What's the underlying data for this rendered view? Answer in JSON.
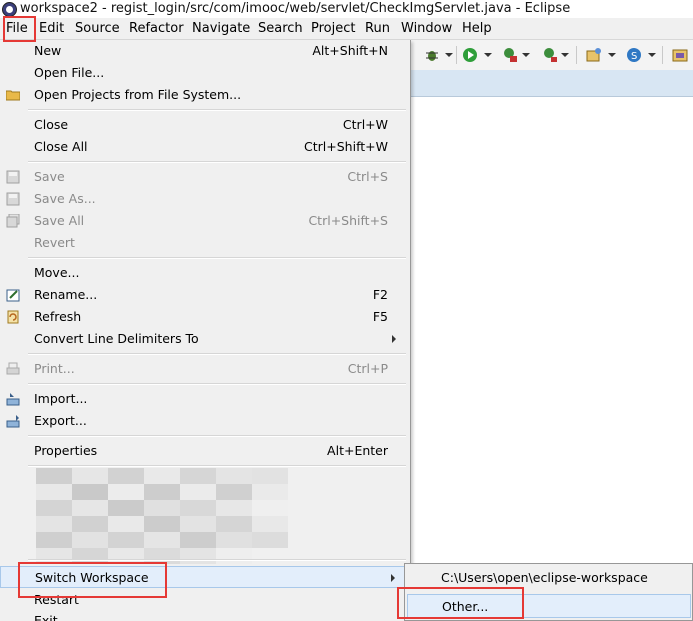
{
  "window": {
    "title": "workspace2 - regist_login/src/com/imooc/web/servlet/CheckImgServlet.java - Eclipse"
  },
  "menubar": {
    "items": [
      "File",
      "Edit",
      "Source",
      "Refactor",
      "Navigate",
      "Search",
      "Project",
      "Run",
      "Window",
      "Help"
    ]
  },
  "file_menu": {
    "new": {
      "label": "New",
      "shortcut": "Alt+Shift+N",
      "has_submenu": true
    },
    "open_file": {
      "label": "Open File..."
    },
    "open_projects": {
      "label": "Open Projects from File System..."
    },
    "close": {
      "label": "Close",
      "shortcut": "Ctrl+W"
    },
    "close_all": {
      "label": "Close All",
      "shortcut": "Ctrl+Shift+W"
    },
    "save": {
      "label": "Save",
      "shortcut": "Ctrl+S",
      "disabled": true
    },
    "save_as": {
      "label": "Save As...",
      "disabled": true
    },
    "save_all": {
      "label": "Save All",
      "shortcut": "Ctrl+Shift+S",
      "disabled": true
    },
    "revert": {
      "label": "Revert",
      "disabled": true
    },
    "move": {
      "label": "Move..."
    },
    "rename": {
      "label": "Rename...",
      "shortcut": "F2"
    },
    "refresh": {
      "label": "Refresh",
      "shortcut": "F5"
    },
    "convert_line_delimiters": {
      "label": "Convert Line Delimiters To",
      "has_submenu": true
    },
    "print": {
      "label": "Print...",
      "shortcut": "Ctrl+P",
      "disabled": true
    },
    "import": {
      "label": "Import..."
    },
    "export": {
      "label": "Export..."
    },
    "properties": {
      "label": "Properties",
      "shortcut": "Alt+Enter"
    },
    "switch_workspace": {
      "label": "Switch Workspace",
      "has_submenu": true,
      "highlighted": true
    },
    "restart": {
      "label": "Restart"
    },
    "exit": {
      "label": "Exit"
    }
  },
  "switch_workspace_submenu": {
    "items": [
      "C:\\Users\\open\\eclipse-workspace",
      "Other..."
    ],
    "highlighted_index": 1
  },
  "colors": {
    "menu_bg": "#f0f0f0",
    "hover_bg": "#e3eefb",
    "annotation_red": "#e53935",
    "disabled_text": "#8a8a8a"
  }
}
